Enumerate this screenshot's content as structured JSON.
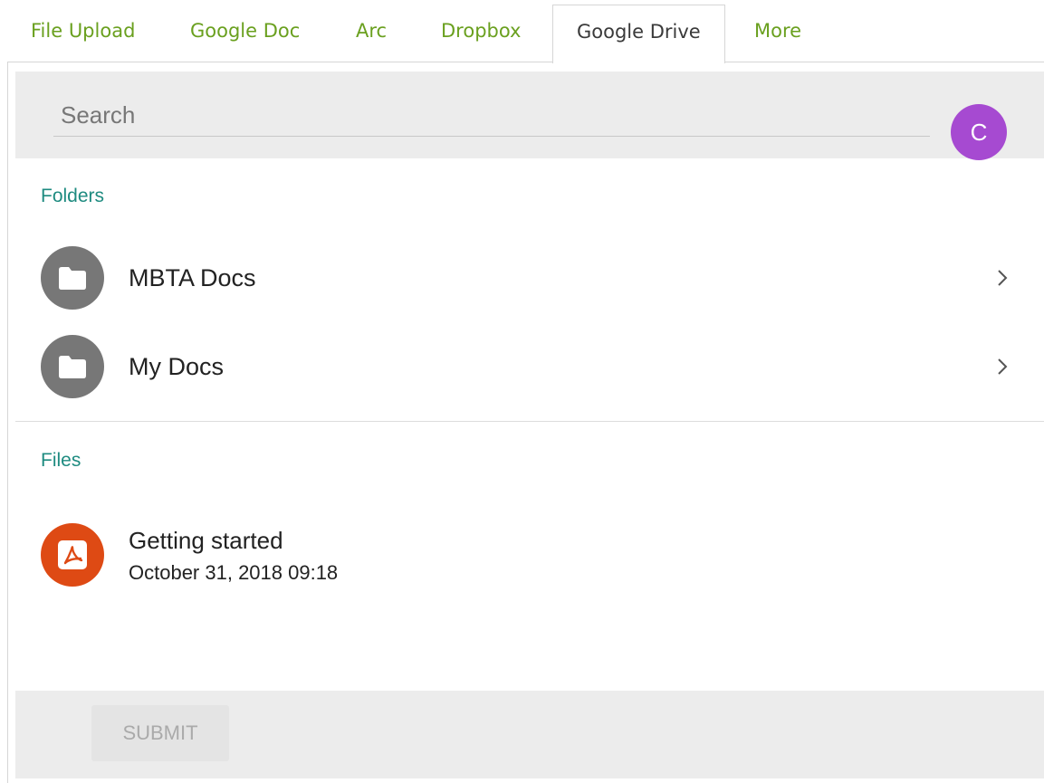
{
  "tabs": [
    {
      "label": "File Upload"
    },
    {
      "label": "Google Doc"
    },
    {
      "label": "Arc"
    },
    {
      "label": "Dropbox"
    },
    {
      "label": "Google Drive",
      "active": true
    },
    {
      "label": "More"
    }
  ],
  "search": {
    "placeholder": "Search"
  },
  "avatar": {
    "initial": "C",
    "color": "#a64ad1"
  },
  "folders": {
    "title": "Folders",
    "items": [
      {
        "label": "MBTA Docs",
        "icon": "folder-icon"
      },
      {
        "label": "My Docs",
        "icon": "folder-icon"
      }
    ]
  },
  "files": {
    "title": "Files",
    "items": [
      {
        "name": "Getting started",
        "date": "October 31, 2018 09:18",
        "icon": "pdf-icon"
      }
    ]
  },
  "footer": {
    "submit_label": "SUBMIT"
  },
  "colors": {
    "tab_text": "#6aa01f",
    "section_title": "#1e8b80",
    "pdf": "#de4a14",
    "folder": "#777777"
  }
}
